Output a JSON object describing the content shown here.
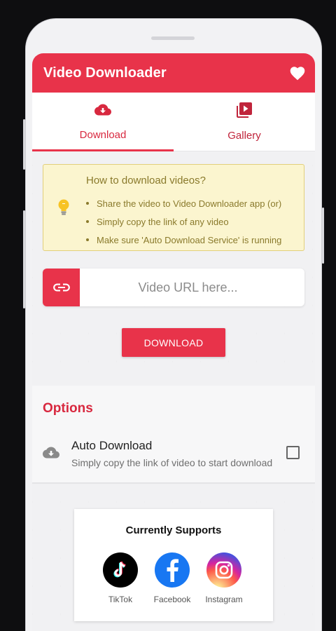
{
  "app": {
    "title": "Video Downloader",
    "accent_color": "#e8334a",
    "header_icon": "heart-icon"
  },
  "tabs": [
    {
      "label": "Download",
      "icon": "cloud-download-icon",
      "active": true
    },
    {
      "label": "Gallery",
      "icon": "video-library-icon",
      "active": false
    }
  ],
  "howto": {
    "title": "How to download videos?",
    "icon": "lightbulb-icon",
    "items": [
      "Share the video to Video Downloader app (or)",
      "Simply copy the link of any video",
      "Make sure 'Auto Download Service' is running"
    ]
  },
  "url_input": {
    "placeholder": "Video URL here...",
    "value": "",
    "icon": "link-icon"
  },
  "download_button": {
    "label": "DOWNLOAD"
  },
  "options": {
    "title": "Options",
    "items": [
      {
        "name": "Auto Download",
        "description": "Simply copy the link of video to start download",
        "icon": "cloud-download-icon",
        "checked": false
      }
    ]
  },
  "supports": {
    "title": "Currently Supports",
    "platforms": [
      {
        "name": "TikTok",
        "icon": "tiktok-icon",
        "color": "#000000"
      },
      {
        "name": "Facebook",
        "icon": "facebook-icon",
        "color": "#1877f2"
      },
      {
        "name": "Instagram",
        "icon": "instagram-icon",
        "color": "#d6249f"
      }
    ]
  }
}
